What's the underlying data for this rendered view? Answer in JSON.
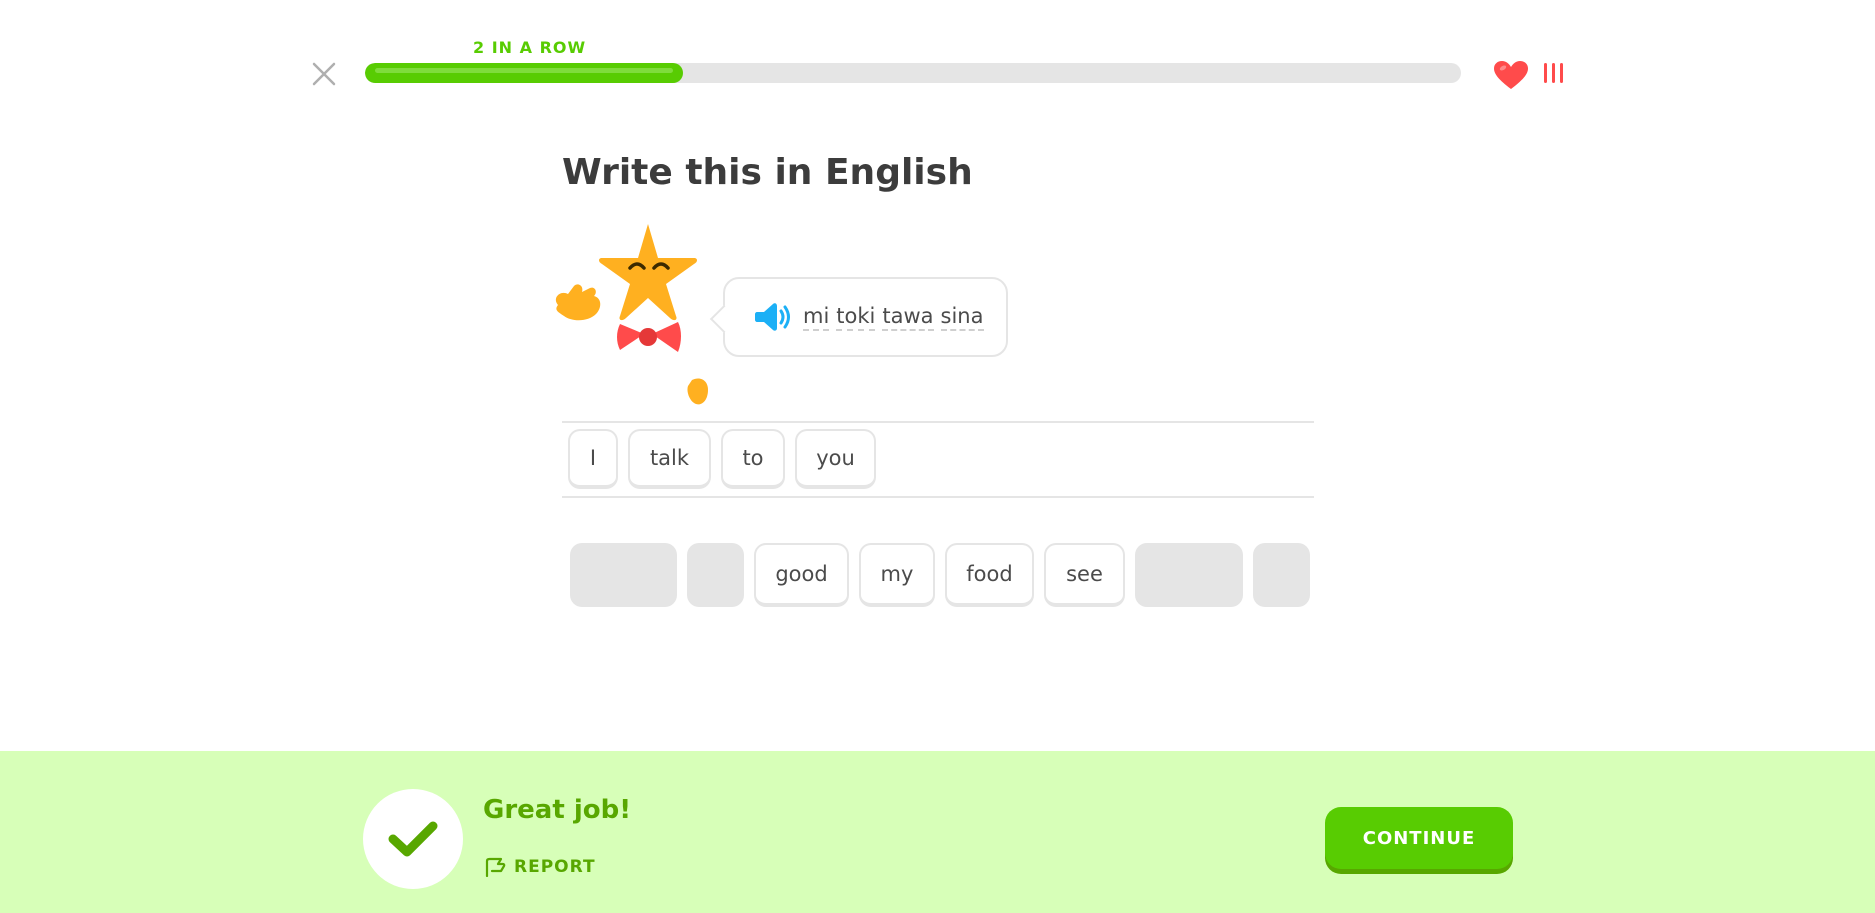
{
  "header": {
    "streak_label": "2 IN A ROW",
    "progress_fraction": 0.29,
    "close_icon": "close-icon",
    "heart_icon": "heart-icon",
    "hearts_count_glyph": "III",
    "accent_color": "#58cc02",
    "heart_color": "#ff4b4b"
  },
  "challenge": {
    "title": "Write this in English",
    "prompt_words": [
      "mi",
      "toki",
      "tawa",
      "sina"
    ],
    "speaker_icon": "speaker-icon"
  },
  "answer": {
    "selected_words": [
      "I",
      "talk",
      "to",
      "you"
    ]
  },
  "word_bank": {
    "visible_words": [
      "good",
      "my",
      "food",
      "see"
    ]
  },
  "footer": {
    "result": "Great job!",
    "report_label": "REPORT",
    "continue_label": "CONTINUE",
    "background_color": "#d7ffb8",
    "text_color": "#58a700"
  }
}
